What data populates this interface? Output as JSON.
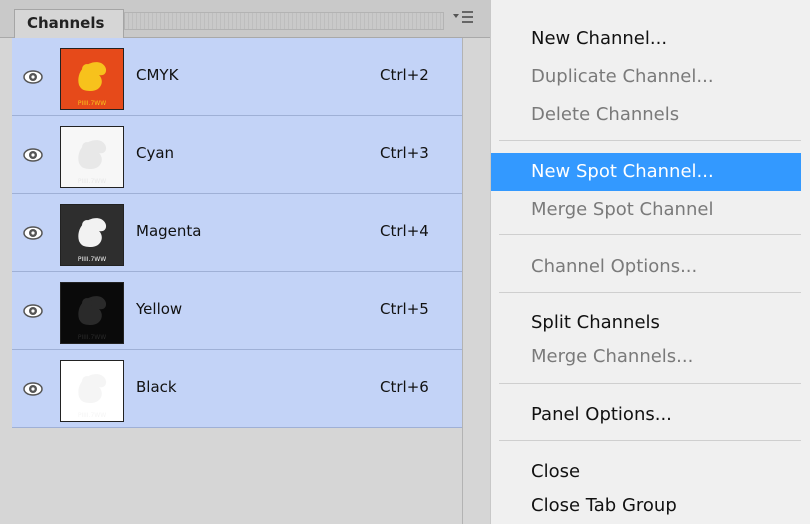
{
  "panel": {
    "tab_label": "Channels",
    "menu_icon": "panel-menu-icon",
    "channels": [
      {
        "name": "CMYK",
        "shortcut": "Ctrl+2",
        "thumb_bg": "#e64a1a",
        "thumb_fg": "#f7c21c",
        "visible": true
      },
      {
        "name": "Cyan",
        "shortcut": "Ctrl+3",
        "thumb_bg": "#f7f7f7",
        "thumb_fg": "#e8e8e8",
        "visible": true
      },
      {
        "name": "Magenta",
        "shortcut": "Ctrl+4",
        "thumb_bg": "#2e2e2e",
        "thumb_fg": "#f2f2f2",
        "visible": true
      },
      {
        "name": "Yellow",
        "shortcut": "Ctrl+5",
        "thumb_bg": "#0a0a0a",
        "thumb_fg": "#2a2a2a",
        "visible": true
      },
      {
        "name": "Black",
        "shortcut": "Ctrl+6",
        "thumb_bg": "#ffffff",
        "thumb_fg": "#f5f5f5",
        "visible": true
      }
    ],
    "thumb_caption": "PIIII.7WW"
  },
  "menu": {
    "items": [
      {
        "label": "New Channel...",
        "enabled": true
      },
      {
        "label": "Duplicate Channel...",
        "enabled": false
      },
      {
        "label": "Delete Channels",
        "enabled": false
      },
      {
        "label": "New Spot Channel...",
        "enabled": true,
        "highlighted": true
      },
      {
        "label": "Merge Spot Channel",
        "enabled": false
      },
      {
        "label": "Channel Options...",
        "enabled": false
      },
      {
        "label": "Split Channels",
        "enabled": true
      },
      {
        "label": "Merge Channels...",
        "enabled": false
      },
      {
        "label": "Panel Options...",
        "enabled": true
      },
      {
        "label": "Close",
        "enabled": true
      },
      {
        "label": "Close Tab Group",
        "enabled": true
      }
    ]
  },
  "colors": {
    "selection": "#c3d3f7",
    "highlight": "#3399ff"
  }
}
